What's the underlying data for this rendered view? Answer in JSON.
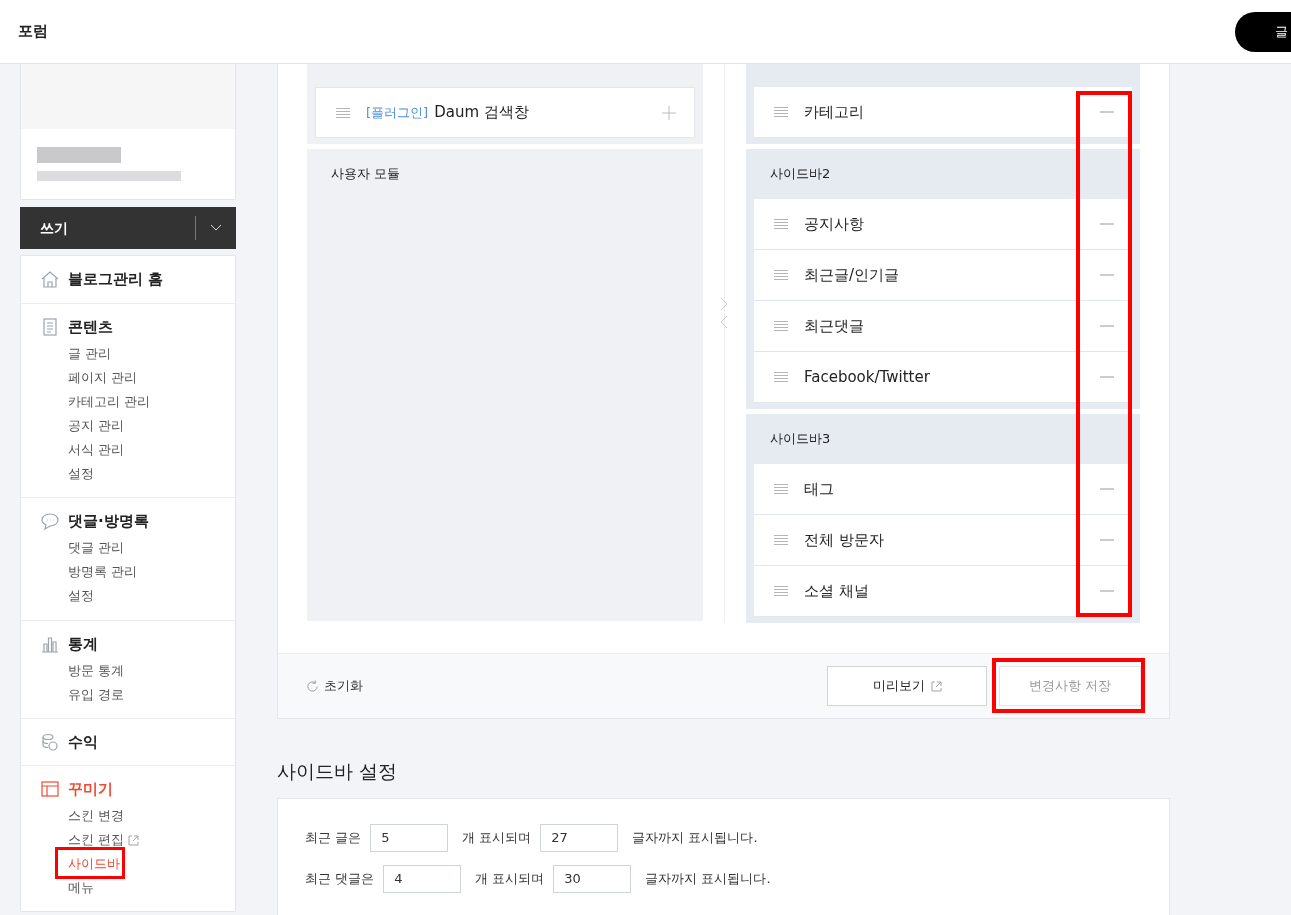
{
  "header": {
    "title": "포럼",
    "write_button": "글"
  },
  "write_menu": {
    "label": "쓰기"
  },
  "nav": [
    {
      "title": "블로그관리 홈",
      "selected": false
    },
    {
      "title": "콘텐츠",
      "selected": false,
      "items": [
        {
          "label": "글 관리",
          "kind": "link",
          "selected": false,
          "highlighted": false
        },
        {
          "label": "페이지 관리",
          "kind": "link",
          "selected": false,
          "highlighted": false
        },
        {
          "label": "카테고리 관리",
          "kind": "link",
          "selected": false,
          "highlighted": false
        },
        {
          "label": "공지 관리",
          "kind": "link",
          "selected": false,
          "highlighted": false
        },
        {
          "label": "서식 관리",
          "kind": "link",
          "selected": false,
          "highlighted": false
        },
        {
          "label": "설정",
          "kind": "link",
          "selected": false,
          "highlighted": false
        }
      ]
    },
    {
      "title": "댓글·방명록",
      "selected": false,
      "items": [
        {
          "label": "댓글 관리",
          "kind": "link",
          "selected": false,
          "highlighted": false
        },
        {
          "label": "방명록 관리",
          "kind": "link",
          "selected": false,
          "highlighted": false
        },
        {
          "label": "설정",
          "kind": "link",
          "selected": false,
          "highlighted": false
        }
      ]
    },
    {
      "title": "통계",
      "selected": false,
      "items": [
        {
          "label": "방문 통계",
          "kind": "link",
          "selected": false,
          "highlighted": false
        },
        {
          "label": "유입 경로",
          "kind": "link",
          "selected": false,
          "highlighted": false
        }
      ]
    },
    {
      "title": "수익",
      "selected": false
    },
    {
      "title": "꾸미기",
      "selected": true,
      "items": [
        {
          "label": "스킨 변경",
          "kind": "link",
          "selected": false,
          "highlighted": false
        },
        {
          "label": "스킨 편집",
          "kind": "external",
          "selected": false,
          "highlighted": false
        },
        {
          "label": "사이드바",
          "kind": "link",
          "selected": true,
          "highlighted": true
        },
        {
          "label": "메뉴",
          "kind": "link",
          "selected": false,
          "highlighted": false
        }
      ]
    }
  ],
  "modules": {
    "groups": [
      {
        "items": [
          {
            "tag": "[플러그인]",
            "label": "Daum 검색창"
          }
        ]
      },
      {
        "title": "사용자 모듈"
      }
    ]
  },
  "sidebars": {
    "remove_buttons_highlighted": true,
    "groups": [
      {
        "items": [
          {
            "label": "카테고리"
          }
        ]
      },
      {
        "title": "사이드바2",
        "items": [
          {
            "label": "공지사항"
          },
          {
            "label": "최근글/인기글"
          },
          {
            "label": "최근댓글"
          },
          {
            "label": "Facebook/Twitter"
          }
        ]
      },
      {
        "title": "사이드바3",
        "items": [
          {
            "label": "태그"
          },
          {
            "label": "전체 방문자"
          },
          {
            "label": "소셜 채널"
          }
        ]
      }
    ]
  },
  "footer": {
    "reset": "초기화",
    "preview": "미리보기",
    "save": {
      "label": "변경사항 저장",
      "disabled": true,
      "highlighted": true
    }
  },
  "settings": {
    "title": "사이드바 설정",
    "rows": [
      {
        "label": "최근 글은",
        "count": "5",
        "middle": "개 표시되며",
        "length": "27",
        "suffix": "글자까지 표시됩니다."
      },
      {
        "label": "최근 댓글은",
        "count": "4",
        "middle": "개 표시되며",
        "length": "30",
        "suffix": "글자까지 표시됩니다."
      }
    ]
  }
}
